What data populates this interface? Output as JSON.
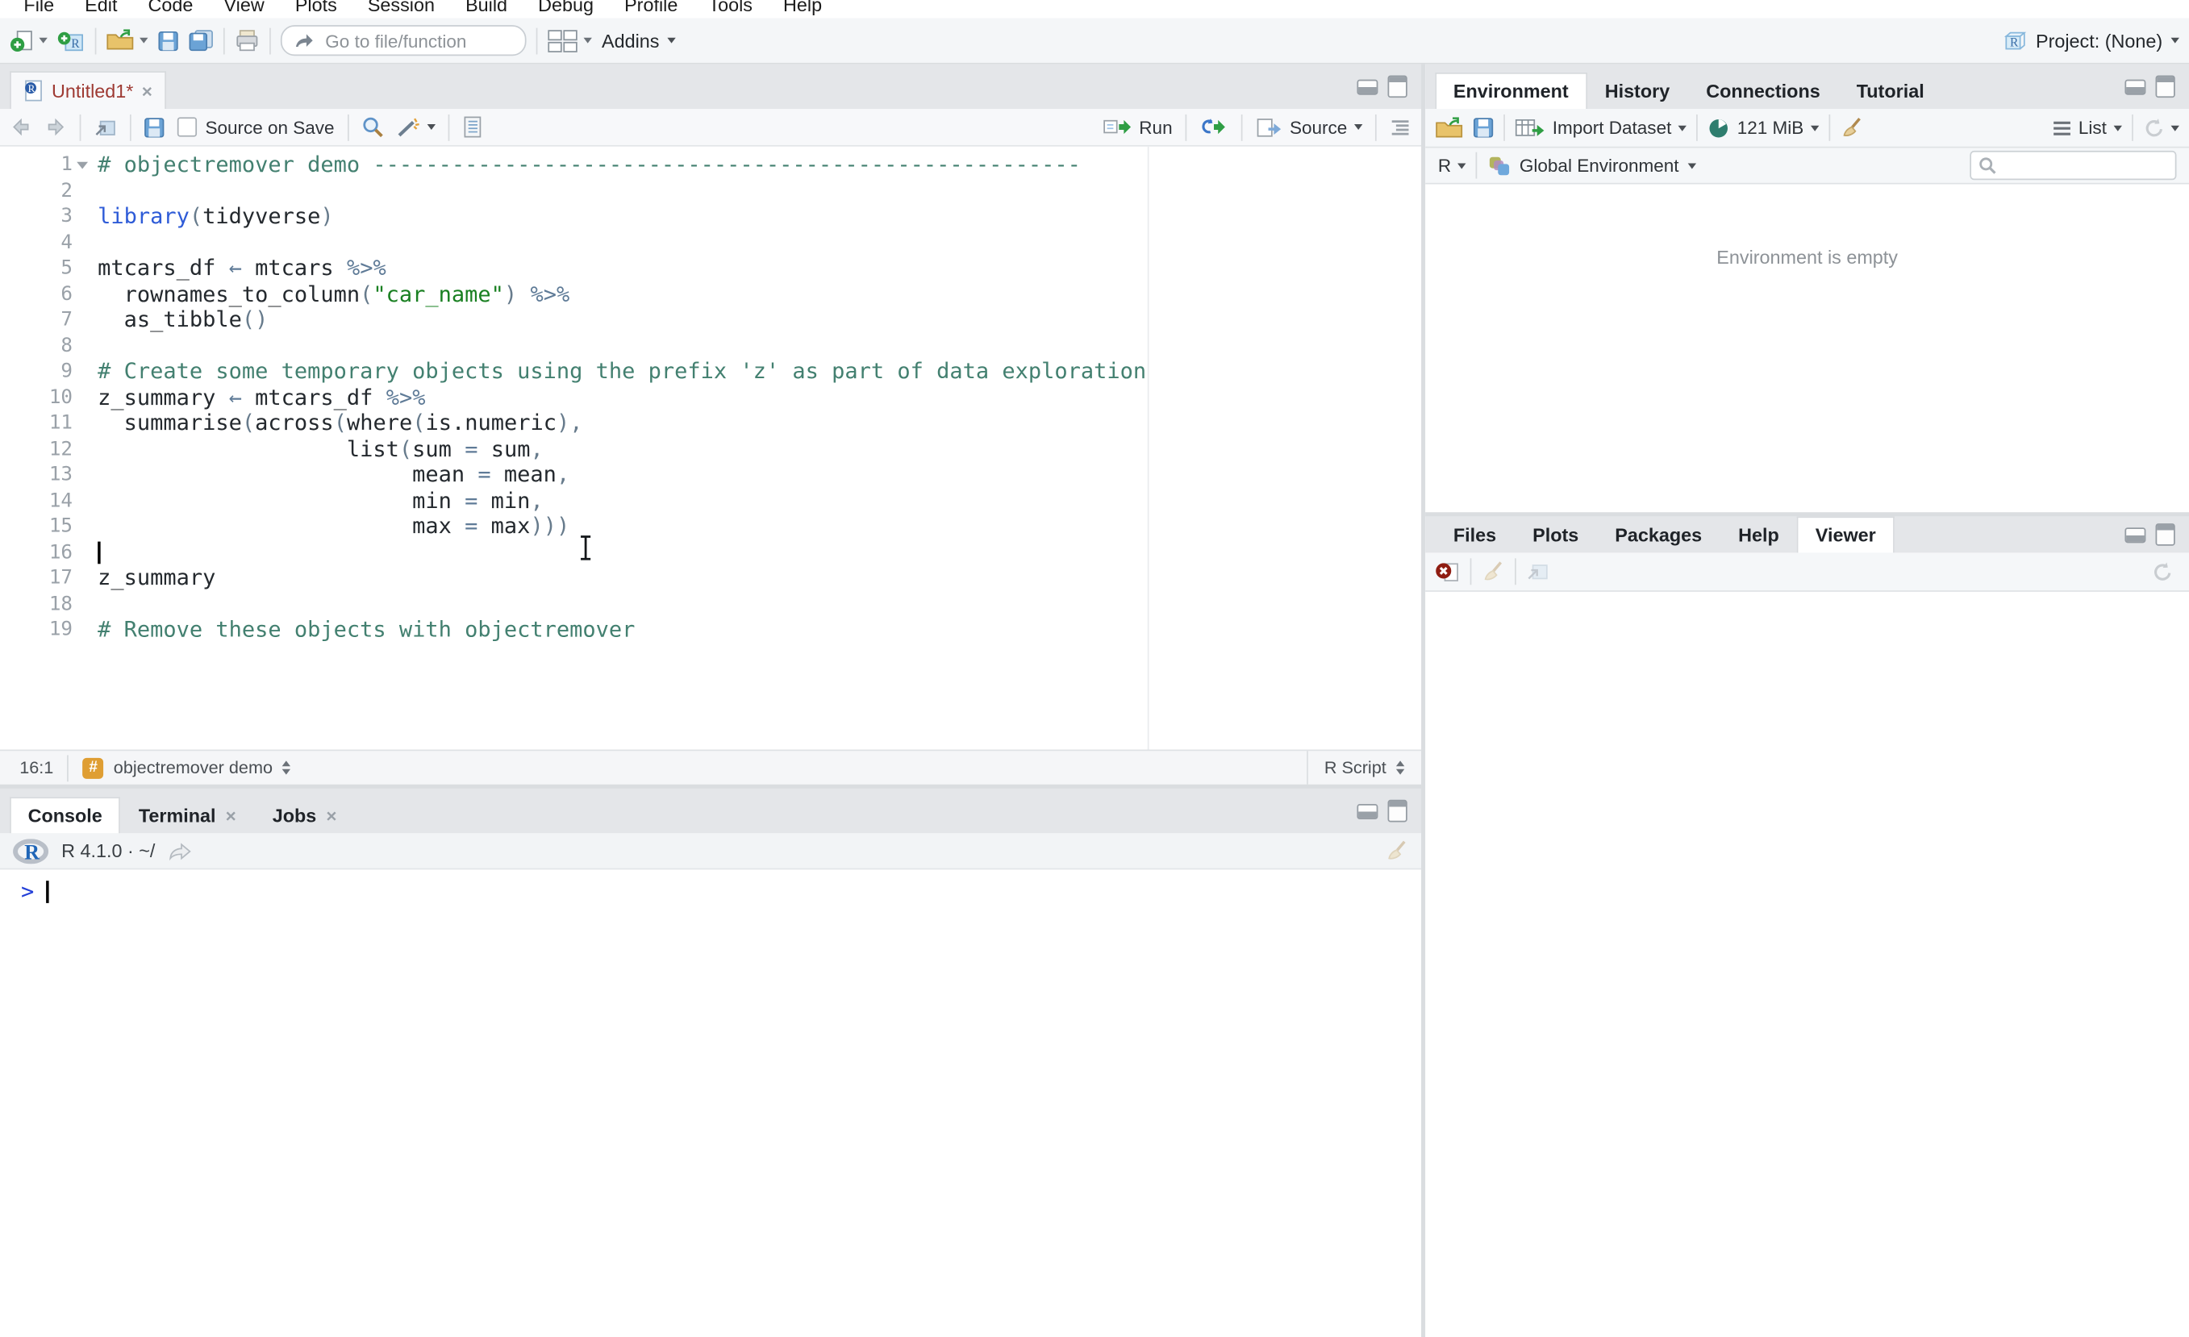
{
  "menubar": {
    "items": [
      "File",
      "Edit",
      "Code",
      "View",
      "Plots",
      "Session",
      "Build",
      "Debug",
      "Profile",
      "Tools",
      "Help"
    ]
  },
  "toolbar": {
    "goto_placeholder": "Go to file/function",
    "addins_label": "Addins",
    "project_label": "Project: (None)"
  },
  "source": {
    "tab": {
      "title": "Untitled1*"
    },
    "toolbar": {
      "source_on_save": "Source on Save",
      "run_label": "Run",
      "source_label": "Source"
    },
    "status": {
      "cursor": "16:1",
      "section": "objectremover demo",
      "filetype": "R Script"
    },
    "editor": {
      "margin_column": 80,
      "lines": [
        {
          "n": 1,
          "fold": true,
          "segs": [
            {
              "s": "comment",
              "t": "# objectremover demo ------------------------------------------------------"
            }
          ]
        },
        {
          "n": 2,
          "segs": []
        },
        {
          "n": 3,
          "segs": [
            {
              "s": "keyword",
              "t": "library"
            },
            {
              "s": "paren",
              "t": "("
            },
            {
              "s": "plain",
              "t": "tidyverse"
            },
            {
              "s": "paren",
              "t": ")"
            }
          ]
        },
        {
          "n": 4,
          "segs": []
        },
        {
          "n": 5,
          "segs": [
            {
              "s": "plain",
              "t": "mtcars_df "
            },
            {
              "s": "op",
              "t": "←"
            },
            {
              "s": "plain",
              "t": " mtcars "
            },
            {
              "s": "op",
              "t": "%>%"
            }
          ]
        },
        {
          "n": 6,
          "segs": [
            {
              "s": "plain",
              "t": "  rownames_to_column"
            },
            {
              "s": "paren",
              "t": "("
            },
            {
              "s": "string",
              "t": "\"car_name\""
            },
            {
              "s": "paren",
              "t": ")"
            },
            {
              "s": "plain",
              "t": " "
            },
            {
              "s": "op",
              "t": "%>%"
            }
          ]
        },
        {
          "n": 7,
          "segs": [
            {
              "s": "plain",
              "t": "  as_tibble"
            },
            {
              "s": "paren",
              "t": "()"
            }
          ]
        },
        {
          "n": 8,
          "segs": []
        },
        {
          "n": 9,
          "segs": [
            {
              "s": "comment",
              "t": "# Create some temporary objects using the prefix 'z' as part of data exploration"
            }
          ]
        },
        {
          "n": 10,
          "segs": [
            {
              "s": "plain",
              "t": "z_summary "
            },
            {
              "s": "op",
              "t": "←"
            },
            {
              "s": "plain",
              "t": " mtcars_df "
            },
            {
              "s": "op",
              "t": "%>%"
            }
          ]
        },
        {
          "n": 11,
          "segs": [
            {
              "s": "plain",
              "t": "  summarise"
            },
            {
              "s": "paren",
              "t": "("
            },
            {
              "s": "plain",
              "t": "across"
            },
            {
              "s": "paren",
              "t": "("
            },
            {
              "s": "plain",
              "t": "where"
            },
            {
              "s": "paren",
              "t": "("
            },
            {
              "s": "plain",
              "t": "is.numeric"
            },
            {
              "s": "paren",
              "t": "),"
            }
          ]
        },
        {
          "n": 12,
          "segs": [
            {
              "s": "plain",
              "t": "                   list"
            },
            {
              "s": "paren",
              "t": "("
            },
            {
              "s": "plain",
              "t": "sum "
            },
            {
              "s": "op",
              "t": "="
            },
            {
              "s": "plain",
              "t": " sum"
            },
            {
              "s": "paren",
              "t": ","
            }
          ]
        },
        {
          "n": 13,
          "segs": [
            {
              "s": "plain",
              "t": "                        mean "
            },
            {
              "s": "op",
              "t": "="
            },
            {
              "s": "plain",
              "t": " mean"
            },
            {
              "s": "paren",
              "t": ","
            }
          ]
        },
        {
          "n": 14,
          "segs": [
            {
              "s": "plain",
              "t": "                        min "
            },
            {
              "s": "op",
              "t": "="
            },
            {
              "s": "plain",
              "t": " min"
            },
            {
              "s": "paren",
              "t": ","
            }
          ]
        },
        {
          "n": 15,
          "segs": [
            {
              "s": "plain",
              "t": "                        max "
            },
            {
              "s": "op",
              "t": "="
            },
            {
              "s": "plain",
              "t": " max"
            },
            {
              "s": "paren",
              "t": ")))"
            }
          ]
        },
        {
          "n": 16,
          "cursor": true,
          "segs": []
        },
        {
          "n": 17,
          "segs": [
            {
              "s": "plain",
              "t": "z_summary"
            }
          ]
        },
        {
          "n": 18,
          "segs": []
        },
        {
          "n": 19,
          "segs": [
            {
              "s": "comment",
              "t": "# Remove these objects with objectremover"
            }
          ]
        }
      ]
    }
  },
  "console": {
    "tabs": [
      {
        "label": "Console",
        "active": true
      },
      {
        "label": "Terminal",
        "close": true
      },
      {
        "label": "Jobs",
        "close": true
      }
    ],
    "header_label": "R 4.1.0 · ~/",
    "prompt": ">"
  },
  "environment": {
    "tabs": [
      {
        "label": "Environment",
        "active": true
      },
      {
        "label": "History"
      },
      {
        "label": "Connections"
      },
      {
        "label": "Tutorial"
      }
    ],
    "toolbar": {
      "import_label": "Import Dataset",
      "memory_label": "121 MiB",
      "list_label": "List"
    },
    "scope": {
      "r_label": "R",
      "scope_label": "Global Environment"
    },
    "empty_label": "Environment is empty"
  },
  "viewer": {
    "tabs": [
      {
        "label": "Files"
      },
      {
        "label": "Plots"
      },
      {
        "label": "Packages"
      },
      {
        "label": "Help"
      },
      {
        "label": "Viewer",
        "active": true
      }
    ]
  },
  "icons": {
    "new-file-icon": "white doc + green plus",
    "new-project-icon": "R cube + green plus",
    "open-folder-icon": "amber folder + green arrow",
    "save-icon": "blue floppy",
    "save-all-icon": "two floppies",
    "print-icon": "printer",
    "goto-arrow-icon": "grey bent arrow",
    "panes-grid-icon": "2x2 squares",
    "project-cube-icon": "light blue R cube",
    "back-icon": "left arrow",
    "forward-icon": "right arrow",
    "popout-icon": "window with arrow",
    "search-icon": "magnifier",
    "wand-icon": "magic wand",
    "notebook-icon": "lined notebook",
    "run-icon": "green run arrow",
    "rerun-icon": "blue redo + green arrow",
    "source-doc-icon": "doc + blue arrow",
    "outline-icon": "document outline bars",
    "import-table-icon": "table + green arrow",
    "memory-pie-icon": "green pie",
    "broom-icon": "broom",
    "list-icon": "three bars",
    "refresh-icon": "circular arrow",
    "r-logo-icon": "R in grey ellipse",
    "share-arrow-icon": "curved arrow",
    "clear-viewer-icon": "doc with red x circle",
    "global-env-blocks-icon": "three colored blocks",
    "fold-arrow-icon": "down triangle",
    "text-cursor": "black caret",
    "mouse-ibeam": "I-beam pointer"
  },
  "colors": {
    "comment": "#438070",
    "keyword": "#2e5bd7",
    "string": "#1a8022",
    "operator": "#5f7b97",
    "unsaved_tab_title": "#9e3a33",
    "prompt_blue": "#2440d8",
    "section_badge": "#df9e33",
    "toolbar_bg": "#f4f6f8",
    "tabbar_bg": "#e4e6e9",
    "run_green": "#2f9e44"
  }
}
